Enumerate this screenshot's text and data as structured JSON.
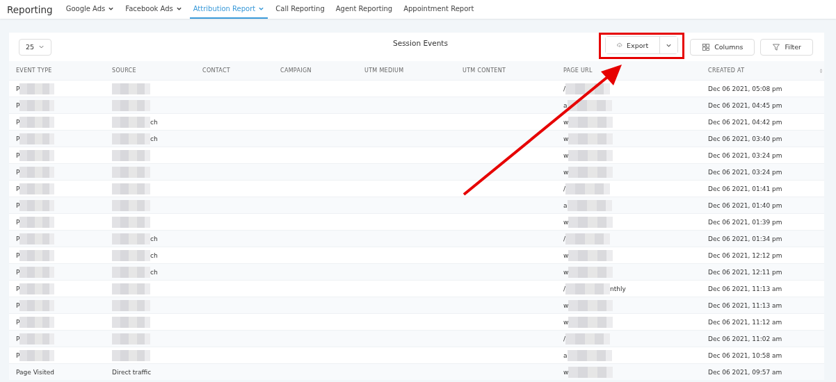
{
  "nav": {
    "title": "Reporting",
    "tabs": [
      {
        "label": "Google Ads",
        "dropdown": true,
        "selected": false
      },
      {
        "label": "Facebook Ads",
        "dropdown": true,
        "selected": false
      },
      {
        "label": "Attribution Report",
        "dropdown": true,
        "selected": true
      },
      {
        "label": "Call Reporting",
        "dropdown": false,
        "selected": false
      },
      {
        "label": "Agent Reporting",
        "dropdown": false,
        "selected": false
      },
      {
        "label": "Appointment Report",
        "dropdown": false,
        "selected": false
      }
    ]
  },
  "toolbar": {
    "page_size": "25",
    "title": "Session Events",
    "export": "Export",
    "columns": "Columns",
    "filter": "Filter"
  },
  "table": {
    "columns": [
      "EVENT TYPE",
      "SOURCE",
      "CONTACT",
      "CAMPAIGN",
      "UTM MEDIUM",
      "UTM CONTENT",
      "PAGE URL",
      "CREATED AT"
    ],
    "rows": [
      [
        [
          {
            "kind": "text",
            "text": "P"
          },
          {
            "kind": "blur"
          }
        ],
        [
          {
            "kind": "blur"
          }
        ],
        [],
        [],
        [],
        [],
        [
          {
            "kind": "text",
            "text": "/"
          },
          {
            "kind": "blur"
          }
        ],
        [
          {
            "kind": "text",
            "text": "Dec 06 2021, 05:08 pm"
          }
        ]
      ],
      [
        [
          {
            "kind": "text",
            "text": "P"
          },
          {
            "kind": "blur"
          }
        ],
        [
          {
            "kind": "blur"
          }
        ],
        [],
        [],
        [],
        [],
        [
          {
            "kind": "text",
            "text": "a"
          },
          {
            "kind": "blur"
          }
        ],
        [
          {
            "kind": "text",
            "text": "Dec 06 2021, 04:45 pm"
          }
        ]
      ],
      [
        [
          {
            "kind": "text",
            "text": "P"
          },
          {
            "kind": "blur"
          }
        ],
        [
          {
            "kind": "blur"
          },
          {
            "kind": "text",
            "text": "ch"
          }
        ],
        [],
        [],
        [],
        [],
        [
          {
            "kind": "text",
            "text": "w"
          },
          {
            "kind": "blur"
          }
        ],
        [
          {
            "kind": "text",
            "text": "Dec 06 2021, 04:42 pm"
          }
        ]
      ],
      [
        [
          {
            "kind": "text",
            "text": "P"
          },
          {
            "kind": "blur"
          }
        ],
        [
          {
            "kind": "blur"
          },
          {
            "kind": "text",
            "text": "ch"
          }
        ],
        [],
        [],
        [],
        [],
        [
          {
            "kind": "text",
            "text": "w"
          },
          {
            "kind": "blur"
          }
        ],
        [
          {
            "kind": "text",
            "text": "Dec 06 2021, 03:40 pm"
          }
        ]
      ],
      [
        [
          {
            "kind": "text",
            "text": "P"
          },
          {
            "kind": "blur"
          }
        ],
        [
          {
            "kind": "blur"
          }
        ],
        [],
        [],
        [],
        [],
        [
          {
            "kind": "text",
            "text": "w"
          },
          {
            "kind": "blur"
          }
        ],
        [
          {
            "kind": "text",
            "text": "Dec 06 2021, 03:24 pm"
          }
        ]
      ],
      [
        [
          {
            "kind": "text",
            "text": "P"
          },
          {
            "kind": "blur"
          }
        ],
        [
          {
            "kind": "blur"
          }
        ],
        [],
        [],
        [],
        [],
        [
          {
            "kind": "text",
            "text": "w"
          },
          {
            "kind": "blur"
          }
        ],
        [
          {
            "kind": "text",
            "text": "Dec 06 2021, 03:24 pm"
          }
        ]
      ],
      [
        [
          {
            "kind": "text",
            "text": "P"
          },
          {
            "kind": "blur"
          }
        ],
        [
          {
            "kind": "blur"
          }
        ],
        [],
        [],
        [],
        [],
        [
          {
            "kind": "text",
            "text": "/"
          },
          {
            "kind": "blur"
          }
        ],
        [
          {
            "kind": "text",
            "text": "Dec 06 2021, 01:41 pm"
          }
        ]
      ],
      [
        [
          {
            "kind": "text",
            "text": "P"
          },
          {
            "kind": "blur"
          }
        ],
        [
          {
            "kind": "blur"
          }
        ],
        [],
        [],
        [],
        [],
        [
          {
            "kind": "text",
            "text": "a"
          },
          {
            "kind": "blur"
          }
        ],
        [
          {
            "kind": "text",
            "text": "Dec 06 2021, 01:40 pm"
          }
        ]
      ],
      [
        [
          {
            "kind": "text",
            "text": "P"
          },
          {
            "kind": "blur"
          }
        ],
        [
          {
            "kind": "blur"
          }
        ],
        [],
        [],
        [],
        [],
        [
          {
            "kind": "text",
            "text": "w"
          },
          {
            "kind": "blur"
          }
        ],
        [
          {
            "kind": "text",
            "text": "Dec 06 2021, 01:39 pm"
          }
        ]
      ],
      [
        [
          {
            "kind": "text",
            "text": "P"
          },
          {
            "kind": "blur"
          }
        ],
        [
          {
            "kind": "blur"
          },
          {
            "kind": "text",
            "text": "ch"
          }
        ],
        [],
        [],
        [],
        [],
        [
          {
            "kind": "text",
            "text": "/"
          },
          {
            "kind": "blur"
          }
        ],
        [
          {
            "kind": "text",
            "text": "Dec 06 2021, 01:34 pm"
          }
        ]
      ],
      [
        [
          {
            "kind": "text",
            "text": "P"
          },
          {
            "kind": "blur"
          }
        ],
        [
          {
            "kind": "blur"
          },
          {
            "kind": "text",
            "text": "ch"
          }
        ],
        [],
        [],
        [],
        [],
        [
          {
            "kind": "text",
            "text": "w"
          },
          {
            "kind": "blur"
          }
        ],
        [
          {
            "kind": "text",
            "text": "Dec 06 2021, 12:12 pm"
          }
        ]
      ],
      [
        [
          {
            "kind": "text",
            "text": "P"
          },
          {
            "kind": "blur"
          }
        ],
        [
          {
            "kind": "blur"
          },
          {
            "kind": "text",
            "text": "ch"
          }
        ],
        [],
        [],
        [],
        [],
        [
          {
            "kind": "text",
            "text": "w"
          },
          {
            "kind": "blur"
          }
        ],
        [
          {
            "kind": "text",
            "text": "Dec 06 2021, 12:11 pm"
          }
        ]
      ],
      [
        [
          {
            "kind": "text",
            "text": "P"
          },
          {
            "kind": "blur"
          }
        ],
        [
          {
            "kind": "blur"
          }
        ],
        [],
        [],
        [],
        [],
        [
          {
            "kind": "text",
            "text": "/"
          },
          {
            "kind": "blur"
          },
          {
            "kind": "text",
            "text": "nthly"
          }
        ],
        [
          {
            "kind": "text",
            "text": "Dec 06 2021, 11:13 am"
          }
        ]
      ],
      [
        [
          {
            "kind": "text",
            "text": "P"
          },
          {
            "kind": "blur"
          }
        ],
        [
          {
            "kind": "blur"
          }
        ],
        [],
        [],
        [],
        [],
        [
          {
            "kind": "text",
            "text": "w"
          },
          {
            "kind": "blur"
          }
        ],
        [
          {
            "kind": "text",
            "text": "Dec 06 2021, 11:13 am"
          }
        ]
      ],
      [
        [
          {
            "kind": "text",
            "text": "P"
          },
          {
            "kind": "blur"
          }
        ],
        [
          {
            "kind": "blur"
          }
        ],
        [],
        [],
        [],
        [],
        [
          {
            "kind": "text",
            "text": "w"
          },
          {
            "kind": "blur"
          }
        ],
        [
          {
            "kind": "text",
            "text": "Dec 06 2021, 11:12 am"
          }
        ]
      ],
      [
        [
          {
            "kind": "text",
            "text": "P"
          },
          {
            "kind": "blur"
          }
        ],
        [
          {
            "kind": "blur"
          }
        ],
        [],
        [],
        [],
        [],
        [
          {
            "kind": "text",
            "text": "/"
          },
          {
            "kind": "blur"
          }
        ],
        [
          {
            "kind": "text",
            "text": "Dec 06 2021, 11:02 am"
          }
        ]
      ],
      [
        [
          {
            "kind": "text",
            "text": "P"
          },
          {
            "kind": "blur"
          }
        ],
        [
          {
            "kind": "blur"
          }
        ],
        [],
        [],
        [],
        [],
        [
          {
            "kind": "text",
            "text": "a"
          },
          {
            "kind": "blur"
          }
        ],
        [
          {
            "kind": "text",
            "text": "Dec 06 2021, 10:58 am"
          }
        ]
      ],
      [
        [
          {
            "kind": "text",
            "text": "Page Visited"
          }
        ],
        [
          {
            "kind": "text",
            "text": "Direct traffic"
          }
        ],
        [],
        [],
        [],
        [],
        [
          {
            "kind": "text",
            "text": "w"
          },
          {
            "kind": "blur"
          }
        ],
        [
          {
            "kind": "text",
            "text": "Dec 06 2021, 09:57 am"
          }
        ]
      ]
    ]
  }
}
